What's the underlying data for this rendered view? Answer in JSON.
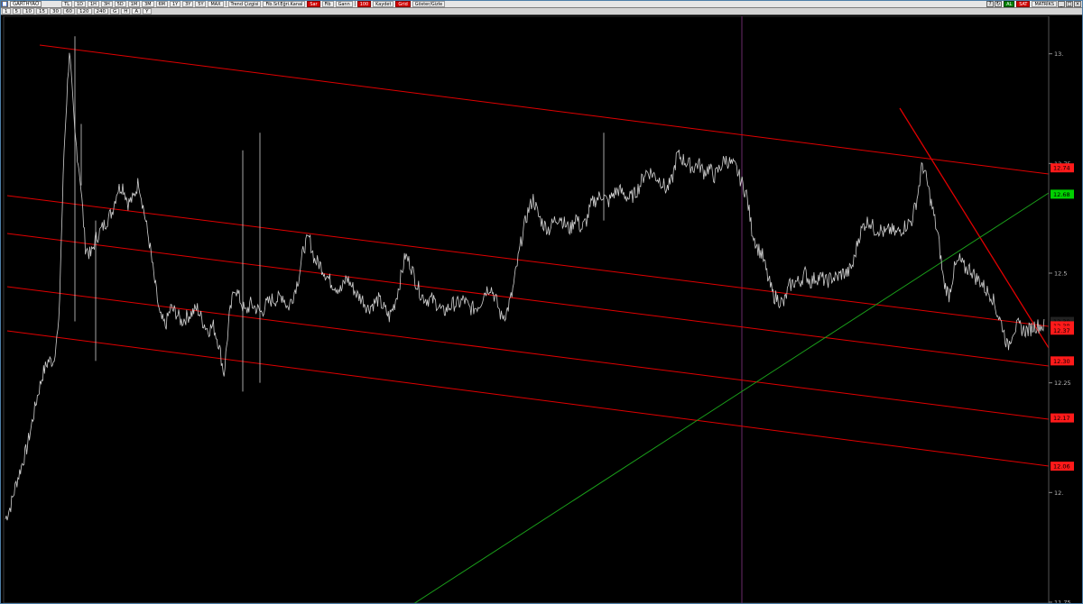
{
  "toolbar": {
    "symbol": "GARTHYAO",
    "currency": "TL",
    "period_buttons": [
      "1D",
      "1H",
      "3H",
      "5D",
      "1M",
      "3M",
      "6M",
      "1Y",
      "3Y",
      "5Y",
      "MAX"
    ],
    "misc_buttons": [
      "1",
      "5",
      "10",
      "15",
      "30",
      "60",
      "120",
      "240",
      "G",
      "H",
      "A",
      "Y"
    ],
    "drawing_group": "Trend Çizgisi",
    "indicator_group": "Fib.Sıf.Eğri.Kanal",
    "action1": "Sar",
    "action2": "Fib",
    "action3": "Gann",
    "zoom": "100",
    "save_label": "Kaydet",
    "grid_label": "Grid",
    "legend_label": "Göster/Gizle",
    "right_tabs": [
      "AL",
      "SAT",
      "MATRİKS"
    ]
  },
  "colors": {
    "background": "#000000",
    "price": "#cfcfcf",
    "channel": "#e00000",
    "support_trend": "#1aa01a",
    "cursor_line": "#6a2a6a",
    "level_label_red": "#ff1a1a",
    "level_label_green": "#00d000"
  },
  "chart_data": {
    "type": "line",
    "title": "",
    "xlabel": "",
    "ylabel": "",
    "ylim": [
      11.75,
      13.1
    ],
    "y_ticks": [
      "13.",
      "12.75",
      "12.5",
      "12.25",
      "12.",
      "11.75"
    ],
    "level_labels": [
      {
        "text": "12.74",
        "value": 12.74,
        "color": "#ff1a1a"
      },
      {
        "text": "12.68",
        "value": 12.68,
        "color": "#00d000"
      },
      {
        "text": "12.39",
        "value": 12.39,
        "color": "#222222"
      },
      {
        "text": "12.38",
        "value": 12.38,
        "color": "#ff1a1a"
      },
      {
        "text": "12.37",
        "value": 12.37,
        "color": "#ff1a1a"
      },
      {
        "text": "12.30",
        "value": 12.3,
        "color": "#ff1a1a"
      },
      {
        "text": "12.17",
        "value": 12.17,
        "color": "#ff1a1a"
      },
      {
        "text": "12.06",
        "value": 12.06,
        "color": "#ff1a1a"
      }
    ],
    "series": [
      {
        "values": [
          11.94,
          11.97,
          12.02,
          12.06,
          12.1,
          12.16,
          12.22,
          12.27,
          12.3,
          12.3,
          12.38,
          12.78,
          13.01,
          12.82,
          12.72,
          12.56,
          12.54,
          12.58,
          12.6,
          12.62,
          12.64,
          12.69,
          12.7,
          12.66,
          12.67,
          12.71,
          12.64,
          12.57,
          12.48,
          12.4,
          12.38,
          12.42,
          12.41,
          12.39,
          12.4,
          12.41,
          12.42,
          12.39,
          12.37,
          12.38,
          12.34,
          12.27,
          12.4,
          12.47,
          12.44,
          12.41,
          12.43,
          12.42,
          12.41,
          12.43,
          12.44,
          12.44,
          12.45,
          12.42,
          12.45,
          12.49,
          12.56,
          12.58,
          12.53,
          12.52,
          12.5,
          12.48,
          12.47,
          12.46,
          12.49,
          12.47,
          12.45,
          12.44,
          12.42,
          12.43,
          12.44,
          12.42,
          12.4,
          12.43,
          12.48,
          12.54,
          12.52,
          12.48,
          12.45,
          12.44,
          12.44,
          12.43,
          12.41,
          12.42,
          12.43,
          12.43,
          12.44,
          12.42,
          12.42,
          12.43,
          12.46,
          12.47,
          12.44,
          12.4,
          12.41,
          12.45,
          12.52,
          12.59,
          12.64,
          12.67,
          12.63,
          12.61,
          12.6,
          12.62,
          12.63,
          12.61,
          12.6,
          12.63,
          12.6,
          12.62,
          12.66,
          12.67,
          12.68,
          12.66,
          12.68,
          12.69,
          12.68,
          12.67,
          12.68,
          12.7,
          12.73,
          12.73,
          12.72,
          12.71,
          12.69,
          12.71,
          12.77,
          12.76,
          12.75,
          12.74,
          12.75,
          12.73,
          12.74,
          12.72,
          12.74,
          12.76,
          12.75,
          12.74,
          12.71,
          12.68,
          12.6,
          12.56,
          12.54,
          12.49,
          12.45,
          12.44,
          12.43,
          12.47,
          12.48,
          12.48,
          12.5,
          12.48,
          12.49,
          12.49,
          12.48,
          12.49,
          12.49,
          12.5,
          12.5,
          12.52,
          12.58,
          12.61,
          12.62,
          12.6,
          12.6,
          12.59,
          12.6,
          12.59,
          12.6,
          12.61,
          12.62,
          12.67,
          12.75,
          12.7,
          12.64,
          12.58,
          12.48,
          12.45,
          12.51,
          12.53,
          12.51,
          12.51,
          12.49,
          12.48,
          12.46,
          12.45,
          12.41,
          12.38,
          12.33,
          12.37,
          12.38,
          12.37,
          12.37,
          12.38,
          12.38
        ]
      }
    ]
  }
}
